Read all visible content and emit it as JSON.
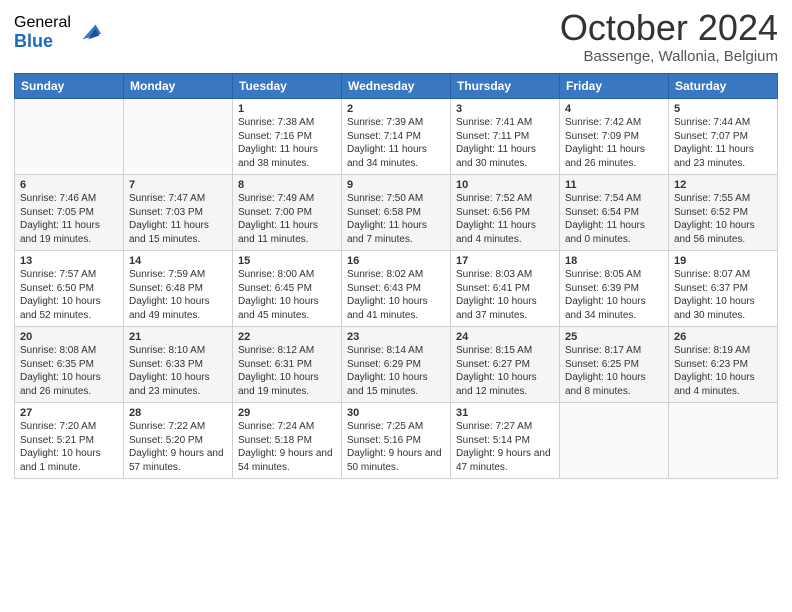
{
  "logo": {
    "general": "General",
    "blue": "Blue"
  },
  "title": "October 2024",
  "subtitle": "Bassenge, Wallonia, Belgium",
  "headers": [
    "Sunday",
    "Monday",
    "Tuesday",
    "Wednesday",
    "Thursday",
    "Friday",
    "Saturday"
  ],
  "weeks": [
    [
      {
        "day": "",
        "info": ""
      },
      {
        "day": "",
        "info": ""
      },
      {
        "day": "1",
        "info": "Sunrise: 7:38 AM\nSunset: 7:16 PM\nDaylight: 11 hours and 38 minutes."
      },
      {
        "day": "2",
        "info": "Sunrise: 7:39 AM\nSunset: 7:14 PM\nDaylight: 11 hours and 34 minutes."
      },
      {
        "day": "3",
        "info": "Sunrise: 7:41 AM\nSunset: 7:11 PM\nDaylight: 11 hours and 30 minutes."
      },
      {
        "day": "4",
        "info": "Sunrise: 7:42 AM\nSunset: 7:09 PM\nDaylight: 11 hours and 26 minutes."
      },
      {
        "day": "5",
        "info": "Sunrise: 7:44 AM\nSunset: 7:07 PM\nDaylight: 11 hours and 23 minutes."
      }
    ],
    [
      {
        "day": "6",
        "info": "Sunrise: 7:46 AM\nSunset: 7:05 PM\nDaylight: 11 hours and 19 minutes."
      },
      {
        "day": "7",
        "info": "Sunrise: 7:47 AM\nSunset: 7:03 PM\nDaylight: 11 hours and 15 minutes."
      },
      {
        "day": "8",
        "info": "Sunrise: 7:49 AM\nSunset: 7:00 PM\nDaylight: 11 hours and 11 minutes."
      },
      {
        "day": "9",
        "info": "Sunrise: 7:50 AM\nSunset: 6:58 PM\nDaylight: 11 hours and 7 minutes."
      },
      {
        "day": "10",
        "info": "Sunrise: 7:52 AM\nSunset: 6:56 PM\nDaylight: 11 hours and 4 minutes."
      },
      {
        "day": "11",
        "info": "Sunrise: 7:54 AM\nSunset: 6:54 PM\nDaylight: 11 hours and 0 minutes."
      },
      {
        "day": "12",
        "info": "Sunrise: 7:55 AM\nSunset: 6:52 PM\nDaylight: 10 hours and 56 minutes."
      }
    ],
    [
      {
        "day": "13",
        "info": "Sunrise: 7:57 AM\nSunset: 6:50 PM\nDaylight: 10 hours and 52 minutes."
      },
      {
        "day": "14",
        "info": "Sunrise: 7:59 AM\nSunset: 6:48 PM\nDaylight: 10 hours and 49 minutes."
      },
      {
        "day": "15",
        "info": "Sunrise: 8:00 AM\nSunset: 6:45 PM\nDaylight: 10 hours and 45 minutes."
      },
      {
        "day": "16",
        "info": "Sunrise: 8:02 AM\nSunset: 6:43 PM\nDaylight: 10 hours and 41 minutes."
      },
      {
        "day": "17",
        "info": "Sunrise: 8:03 AM\nSunset: 6:41 PM\nDaylight: 10 hours and 37 minutes."
      },
      {
        "day": "18",
        "info": "Sunrise: 8:05 AM\nSunset: 6:39 PM\nDaylight: 10 hours and 34 minutes."
      },
      {
        "day": "19",
        "info": "Sunrise: 8:07 AM\nSunset: 6:37 PM\nDaylight: 10 hours and 30 minutes."
      }
    ],
    [
      {
        "day": "20",
        "info": "Sunrise: 8:08 AM\nSunset: 6:35 PM\nDaylight: 10 hours and 26 minutes."
      },
      {
        "day": "21",
        "info": "Sunrise: 8:10 AM\nSunset: 6:33 PM\nDaylight: 10 hours and 23 minutes."
      },
      {
        "day": "22",
        "info": "Sunrise: 8:12 AM\nSunset: 6:31 PM\nDaylight: 10 hours and 19 minutes."
      },
      {
        "day": "23",
        "info": "Sunrise: 8:14 AM\nSunset: 6:29 PM\nDaylight: 10 hours and 15 minutes."
      },
      {
        "day": "24",
        "info": "Sunrise: 8:15 AM\nSunset: 6:27 PM\nDaylight: 10 hours and 12 minutes."
      },
      {
        "day": "25",
        "info": "Sunrise: 8:17 AM\nSunset: 6:25 PM\nDaylight: 10 hours and 8 minutes."
      },
      {
        "day": "26",
        "info": "Sunrise: 8:19 AM\nSunset: 6:23 PM\nDaylight: 10 hours and 4 minutes."
      }
    ],
    [
      {
        "day": "27",
        "info": "Sunrise: 7:20 AM\nSunset: 5:21 PM\nDaylight: 10 hours and 1 minute."
      },
      {
        "day": "28",
        "info": "Sunrise: 7:22 AM\nSunset: 5:20 PM\nDaylight: 9 hours and 57 minutes."
      },
      {
        "day": "29",
        "info": "Sunrise: 7:24 AM\nSunset: 5:18 PM\nDaylight: 9 hours and 54 minutes."
      },
      {
        "day": "30",
        "info": "Sunrise: 7:25 AM\nSunset: 5:16 PM\nDaylight: 9 hours and 50 minutes."
      },
      {
        "day": "31",
        "info": "Sunrise: 7:27 AM\nSunset: 5:14 PM\nDaylight: 9 hours and 47 minutes."
      },
      {
        "day": "",
        "info": ""
      },
      {
        "day": "",
        "info": ""
      }
    ]
  ]
}
